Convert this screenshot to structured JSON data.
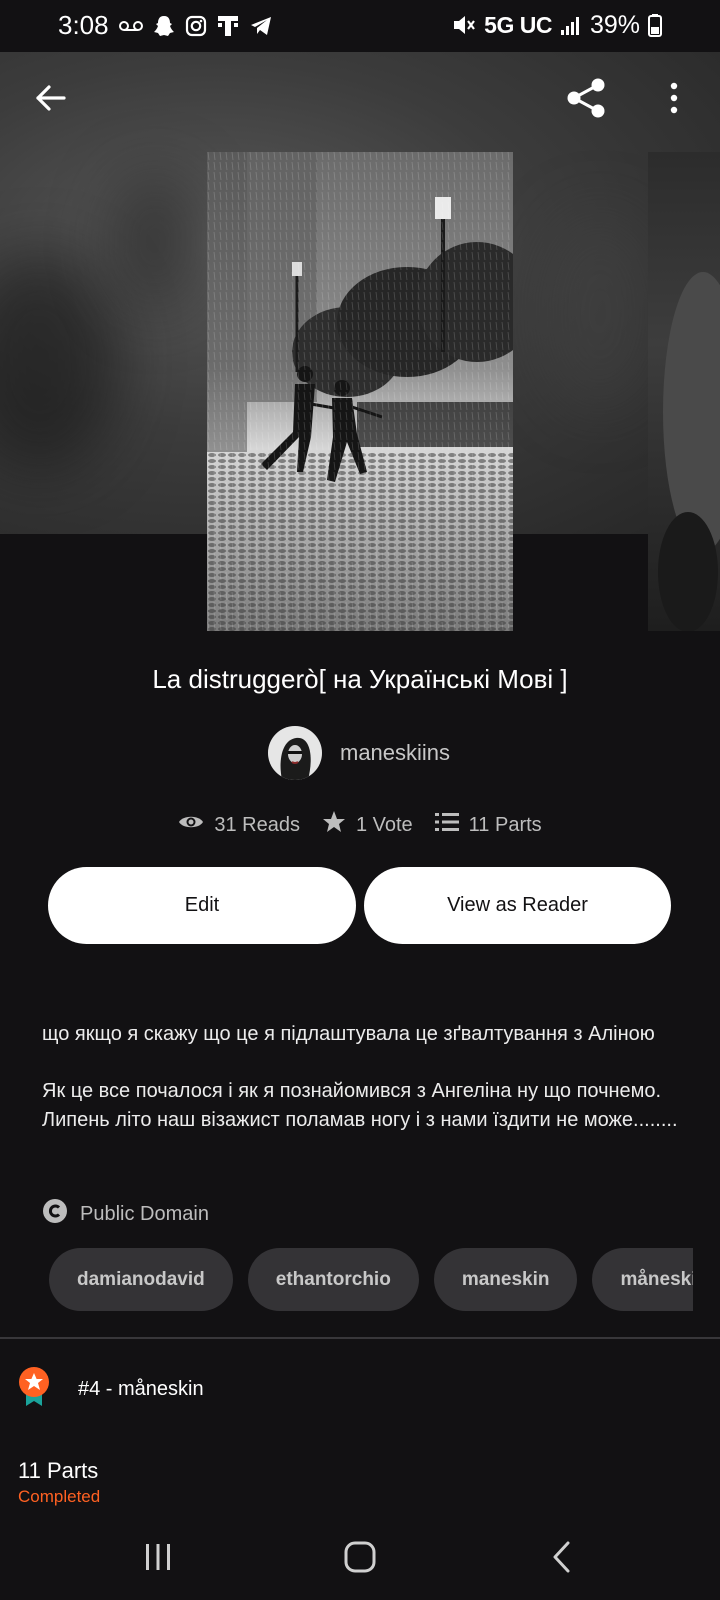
{
  "status_bar": {
    "time": "3:08",
    "network": "5G UC",
    "battery": "39%",
    "left_icons": [
      "voicemail-icon",
      "snapchat-icon",
      "instagram-icon",
      "t-mobile-icon",
      "telegram-icon"
    ],
    "right_icons": [
      "mute-icon",
      "signal-icon",
      "battery-icon"
    ]
  },
  "toolbar": {
    "back_icon": "arrow-left-icon",
    "share_icon": "share-icon",
    "more_icon": "more-vertical-icon"
  },
  "story": {
    "title": "La distruggerò[ на Українські Мові ]",
    "author": "maneskiins",
    "reads": "31 Reads",
    "votes": "1 Vote",
    "parts": "11 Parts"
  },
  "actions": {
    "edit_label": "Edit",
    "reader_label": "View as Reader"
  },
  "description": {
    "paragraph1": "що якщо я скажу що це я підлаштувала це зґвалтування з Аліною",
    "paragraph2": " Як це все почалося і як я познайомився з Ангеліна ну що почнемо. Липень літо наш візажист поламав ногу і з нами їздити не може........"
  },
  "license": "Public Domain",
  "tags": [
    "damianodavid",
    "ethantorchio",
    "maneskin",
    "måneskin"
  ],
  "ranking": {
    "label": "#4 - måneskin"
  },
  "parts_section": {
    "title": "11 Parts",
    "status": "Completed"
  },
  "colors": {
    "background": "#121113",
    "accent": "#ff6122",
    "button_bg": "#ffffff",
    "tag_bg": "#343336"
  }
}
